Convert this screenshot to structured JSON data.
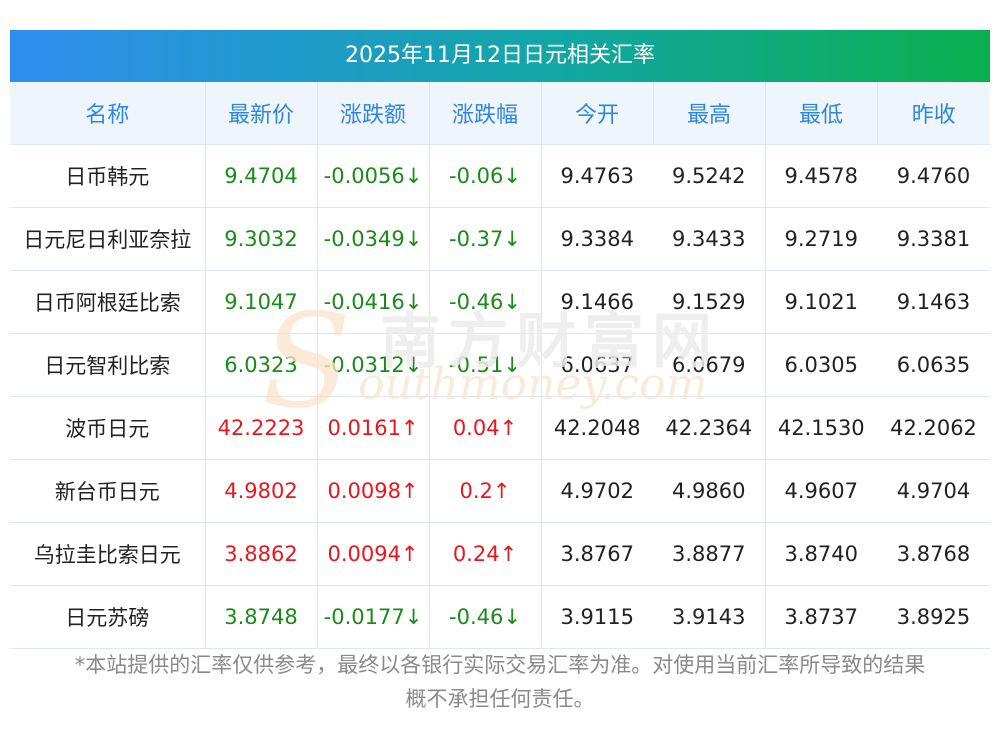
{
  "title": "2025年11月12日日元相关汇率",
  "headers": [
    "名称",
    "最新价",
    "涨跌额",
    "涨跌幅",
    "今开",
    "最高",
    "最低",
    "昨收"
  ],
  "rows": [
    {
      "name": "日币韩元",
      "latest": "9.4704",
      "change": "-0.0056↓",
      "pct": "-0.06↓",
      "open": "9.4763",
      "high": "9.5242",
      "low": "9.4578",
      "prev": "9.4760",
      "trend": "down"
    },
    {
      "name": "日元尼日利亚奈拉",
      "latest": "9.3032",
      "change": "-0.0349↓",
      "pct": "-0.37↓",
      "open": "9.3384",
      "high": "9.3433",
      "low": "9.2719",
      "prev": "9.3381",
      "trend": "down"
    },
    {
      "name": "日币阿根廷比索",
      "latest": "9.1047",
      "change": "-0.0416↓",
      "pct": "-0.46↓",
      "open": "9.1466",
      "high": "9.1529",
      "low": "9.1021",
      "prev": "9.1463",
      "trend": "down"
    },
    {
      "name": "日元智利比索",
      "latest": "6.0323",
      "change": "-0.0312↓",
      "pct": "-0.51↓",
      "open": "6.0637",
      "high": "6.0679",
      "low": "6.0305",
      "prev": "6.0635",
      "trend": "down"
    },
    {
      "name": "波币日元",
      "latest": "42.2223",
      "change": "0.0161↑",
      "pct": "0.04↑",
      "open": "42.2048",
      "high": "42.2364",
      "low": "42.1530",
      "prev": "42.2062",
      "trend": "up"
    },
    {
      "name": "新台币日元",
      "latest": "4.9802",
      "change": "0.0098↑",
      "pct": "0.2↑",
      "open": "4.9702",
      "high": "4.9860",
      "low": "4.9607",
      "prev": "4.9704",
      "trend": "up"
    },
    {
      "name": "乌拉圭比索日元",
      "latest": "3.8862",
      "change": "0.0094↑",
      "pct": "0.24↑",
      "open": "3.8767",
      "high": "3.8877",
      "low": "3.8740",
      "prev": "3.8768",
      "trend": "up"
    },
    {
      "name": "日元苏磅",
      "latest": "3.8748",
      "change": "-0.0177↓",
      "pct": "-0.46↓",
      "open": "3.9115",
      "high": "3.9143",
      "low": "3.8737",
      "prev": "3.8925",
      "trend": "down"
    }
  ],
  "watermark": {
    "s": "S",
    "cn": "南方财富网",
    "en": "outhmoney.com"
  },
  "note_line1": "*本站提供的汇率仅供参考，最终以各银行实际交易汇率为准。对使用当前汇率所导致的结果",
  "note_line2": "概不承担任何责任。",
  "colors": {
    "up": "#e8171d",
    "down": "#1b8a1b",
    "header_text": "#2f86e0"
  }
}
